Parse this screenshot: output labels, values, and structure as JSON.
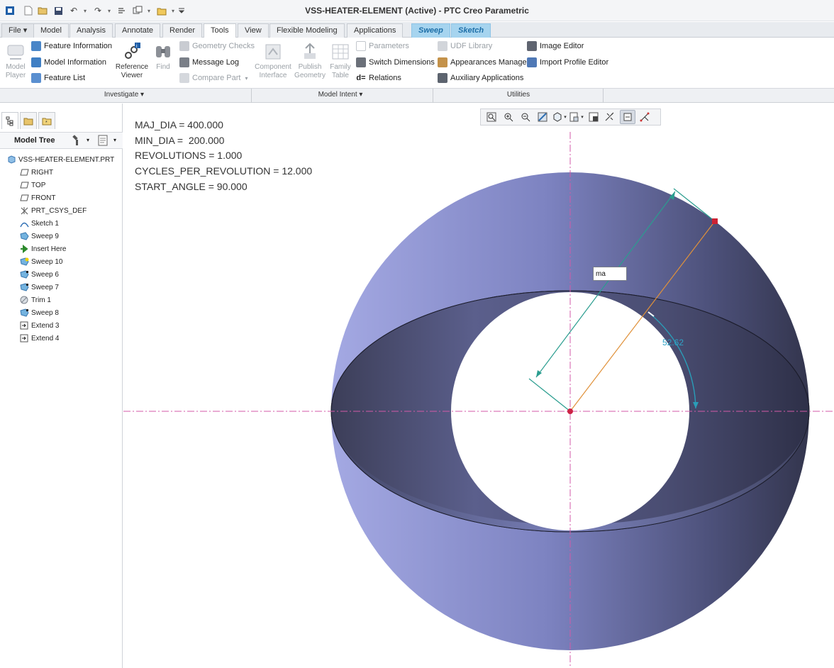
{
  "window": {
    "title": "VSS-HEATER-ELEMENT (Active) - PTC Creo Parametric"
  },
  "tabs": [
    {
      "label": "File",
      "type": "file"
    },
    {
      "label": "Model"
    },
    {
      "label": "Analysis"
    },
    {
      "label": "Annotate"
    },
    {
      "label": "Render"
    },
    {
      "label": "Tools",
      "active": true
    },
    {
      "label": "View"
    },
    {
      "label": "Flexible Modeling"
    },
    {
      "label": "Applications"
    },
    {
      "label": "Sweep",
      "type": "ctx"
    },
    {
      "label": "Sketch",
      "type": "ctx"
    }
  ],
  "ribbon": {
    "investigate": {
      "model_player": "Model\nPlayer",
      "feature_information": "Feature Information",
      "model_information": "Model Information",
      "feature_list": "Feature List",
      "reference_viewer": "Reference\nViewer",
      "find": "Find",
      "geometry_checks": "Geometry Checks",
      "message_log": "Message Log",
      "compare_part": "Compare Part"
    },
    "model_intent": {
      "component_interface": "Component\nInterface",
      "publish_geometry": "Publish\nGeometry",
      "family_table": "Family\nTable",
      "parameters": "Parameters",
      "switch_dimensions": "Switch Dimensions",
      "relations": "Relations"
    },
    "utilities": {
      "udf_library": "UDF Library",
      "appearances_manager": "Appearances Manager",
      "auxiliary_applications": "Auxiliary Applications",
      "image_editor": "Image Editor",
      "import_profile_editor": "Import Profile Editor"
    },
    "groups": {
      "investigate": "Investigate",
      "model_intent": "Model Intent",
      "utilities": "Utilities"
    }
  },
  "model_tree": {
    "header": "Model Tree",
    "items": [
      {
        "label": "VSS-HEATER-ELEMENT.PRT",
        "icon": "part-icon"
      },
      {
        "label": "RIGHT",
        "icon": "datum-plane-icon"
      },
      {
        "label": "TOP",
        "icon": "datum-plane-icon"
      },
      {
        "label": "FRONT",
        "icon": "datum-plane-icon"
      },
      {
        "label": "PRT_CSYS_DEF",
        "icon": "csys-icon"
      },
      {
        "label": "Sketch 1",
        "icon": "sketch-icon"
      },
      {
        "label": "Sweep 9",
        "icon": "sweep-icon"
      },
      {
        "label": "Insert Here",
        "icon": "insert-arrow-icon"
      },
      {
        "label": "Sweep 10",
        "icon": "sweep-active-icon"
      },
      {
        "label": "Sweep 6",
        "icon": "sweep-icon"
      },
      {
        "label": "Sweep 7",
        "icon": "sweep-icon"
      },
      {
        "label": "Trim 1",
        "icon": "trim-icon"
      },
      {
        "label": "Sweep 8",
        "icon": "sweep-icon"
      },
      {
        "label": "Extend 3",
        "icon": "extend-icon"
      },
      {
        "label": "Extend 4",
        "icon": "extend-icon"
      }
    ]
  },
  "parameters": [
    "MAJ_DIA = 400.000",
    "MIN_DIA =  200.000",
    "REVOLUTIONS = 1.000",
    "CYCLES_PER_REVOLUTION = 12.000",
    "START_ANGLE = 90.000"
  ],
  "graphics_toolbar": [
    "refit-icon",
    "zoom-in-icon",
    "zoom-out-icon",
    "repaint-icon",
    "display-style-icon",
    "saved-views-icon",
    "view-manager-icon",
    "annotation-display-icon",
    "datum-display-icon",
    "spin-center-icon"
  ],
  "dimension_edit": {
    "value": "ma"
  },
  "angle_dimension": "52.62",
  "colors": {
    "surface": "#7f86c0",
    "surface_dark": "#2f3248",
    "accent_tab": "#a6d4ef",
    "dim_line": "#2a9d8f",
    "angle": "#2fa4c8"
  }
}
